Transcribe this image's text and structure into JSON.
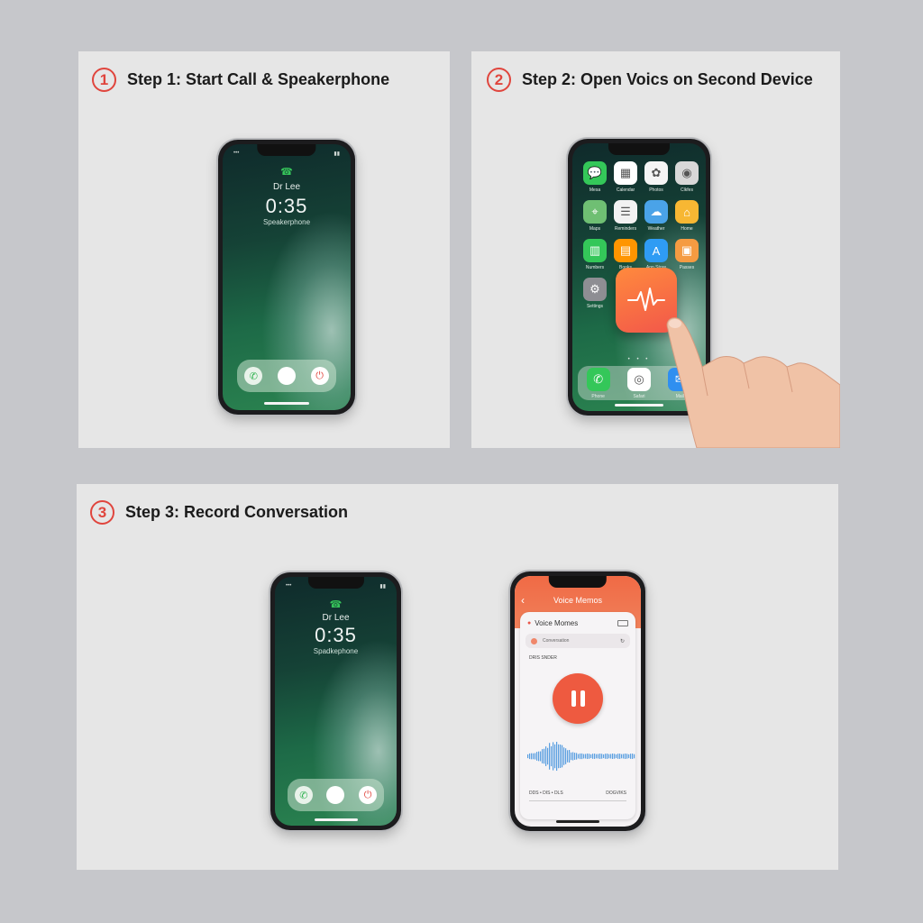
{
  "steps": [
    {
      "number": "1",
      "title": "Step 1: Start Call & Speakerphone"
    },
    {
      "number": "2",
      "title": "Step 2: Open Voics on Second Device"
    },
    {
      "number": "3",
      "title": "Step 3: Record Conversation"
    }
  ],
  "call_screen": {
    "caller": "Dr Lee",
    "timer": "0:35",
    "mode": "Speakerphone"
  },
  "call_screen_2": {
    "caller": "Dr Lee",
    "timer": "0:35",
    "mode": "Spadkephone"
  },
  "home_screen": {
    "apps": [
      {
        "label": "Mesa",
        "color": "#34c759",
        "icon": "message-icon"
      },
      {
        "label": "Calendar",
        "color": "#ffffff",
        "icon": "calendar-icon"
      },
      {
        "label": "Photos",
        "color": "#f5f5f5",
        "icon": "photos-icon"
      },
      {
        "label": "Clkfes",
        "color": "#d8d8d8",
        "icon": "camera-icon"
      },
      {
        "label": "Maps",
        "color": "#6fbf73",
        "icon": "maps-icon"
      },
      {
        "label": "Reminders",
        "color": "#f2f2f2",
        "icon": "reminders-icon"
      },
      {
        "label": "Weather",
        "color": "#4aa3e8",
        "icon": "weather-icon"
      },
      {
        "label": "Home",
        "color": "#f7b733",
        "icon": "home-icon"
      },
      {
        "label": "Numbers",
        "color": "#34c759",
        "icon": "numbers-icon"
      },
      {
        "label": "Books",
        "color": "#ff9500",
        "icon": "books-icon"
      },
      {
        "label": "App Store",
        "color": "#2f9cf4",
        "icon": "app-store-icon"
      },
      {
        "label": "Passes",
        "color": "#f59b42",
        "icon": "wallet-icon"
      },
      {
        "label": "Settings",
        "color": "#8e8e93",
        "icon": "settings-icon"
      }
    ],
    "dock": [
      {
        "label": "Phone",
        "color": "#34c759",
        "icon": "phone-icon"
      },
      {
        "label": "Safari",
        "color": "#ffffff",
        "icon": "safari-icon"
      },
      {
        "label": "Mail",
        "color": "#2f8ff0",
        "icon": "mail-icon"
      }
    ],
    "highlight_app": {
      "icon": "voice-memos-icon",
      "color_from": "#ff8a3d",
      "color_to": "#f2574a"
    }
  },
  "voice_memos": {
    "top_title": "Voice Memos",
    "card_title": "Voice Momes",
    "row_text": "Conversation",
    "small_label": "DRIS SNDER",
    "footer_left": "DDS • DIS • DLS",
    "footer_right": "DOGVIKS",
    "accent": "#ee5a40"
  }
}
